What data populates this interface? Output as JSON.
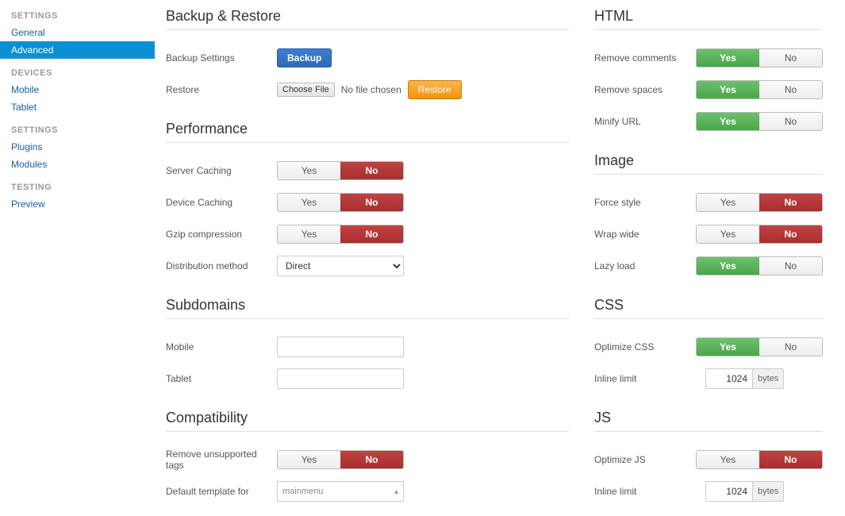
{
  "sidebar": {
    "groups": [
      {
        "header": "SETTINGS",
        "items": [
          {
            "label": "General"
          },
          {
            "label": "Advanced",
            "active": true
          }
        ]
      },
      {
        "header": "DEVICES",
        "items": [
          {
            "label": "Mobile"
          },
          {
            "label": "Tablet"
          }
        ]
      },
      {
        "header": "SETTINGS",
        "items": [
          {
            "label": "Plugins"
          },
          {
            "label": "Modules"
          }
        ]
      },
      {
        "header": "TESTING",
        "items": [
          {
            "label": "Preview"
          }
        ]
      }
    ]
  },
  "left": {
    "sections": {
      "backup_restore": "Backup & Restore",
      "performance": "Performance",
      "subdomains": "Subdomains",
      "compatibility": "Compatibility"
    },
    "labels": {
      "backup_settings": "Backup Settings",
      "restore": "Restore",
      "server_caching": "Server Caching",
      "device_caching": "Device Caching",
      "gzip": "Gzip compression",
      "distribution": "Distribution method",
      "mobile": "Mobile",
      "tablet": "Tablet",
      "remove_unsupported": "Remove unsupported tags",
      "default_template": "Default template for"
    },
    "buttons": {
      "backup": "Backup",
      "choose_file": "Choose File",
      "restore": "Restore"
    },
    "file_status": "No file chosen",
    "toggle": {
      "yes": "Yes",
      "no": "No"
    },
    "distribution_value": "Direct",
    "template_value": "mainmenu",
    "values": {
      "server_caching": "no",
      "device_caching": "no",
      "gzip": "no",
      "remove_unsupported": "no"
    }
  },
  "right": {
    "sections": {
      "html": "HTML",
      "image": "Image",
      "css": "CSS",
      "js": "JS"
    },
    "labels": {
      "remove_comments": "Remove comments",
      "remove_spaces": "Remove spaces",
      "minify_url": "Minify URL",
      "force_style": "Force style",
      "wrap_wide": "Wrap wide",
      "lazy_load": "Lazy load",
      "optimize_css": "Optimize CSS",
      "inline_limit": "Inline limit",
      "optimize_js": "Optimize JS"
    },
    "toggle": {
      "yes": "Yes",
      "no": "No"
    },
    "values": {
      "remove_comments": "yes",
      "remove_spaces": "yes",
      "minify_url": "yes",
      "force_style": "no",
      "wrap_wide": "no",
      "lazy_load": "yes",
      "optimize_css": "yes",
      "optimize_js": "no",
      "css_inline_limit": "1024",
      "js_inline_limit": "1024"
    },
    "unit": "bytes"
  }
}
